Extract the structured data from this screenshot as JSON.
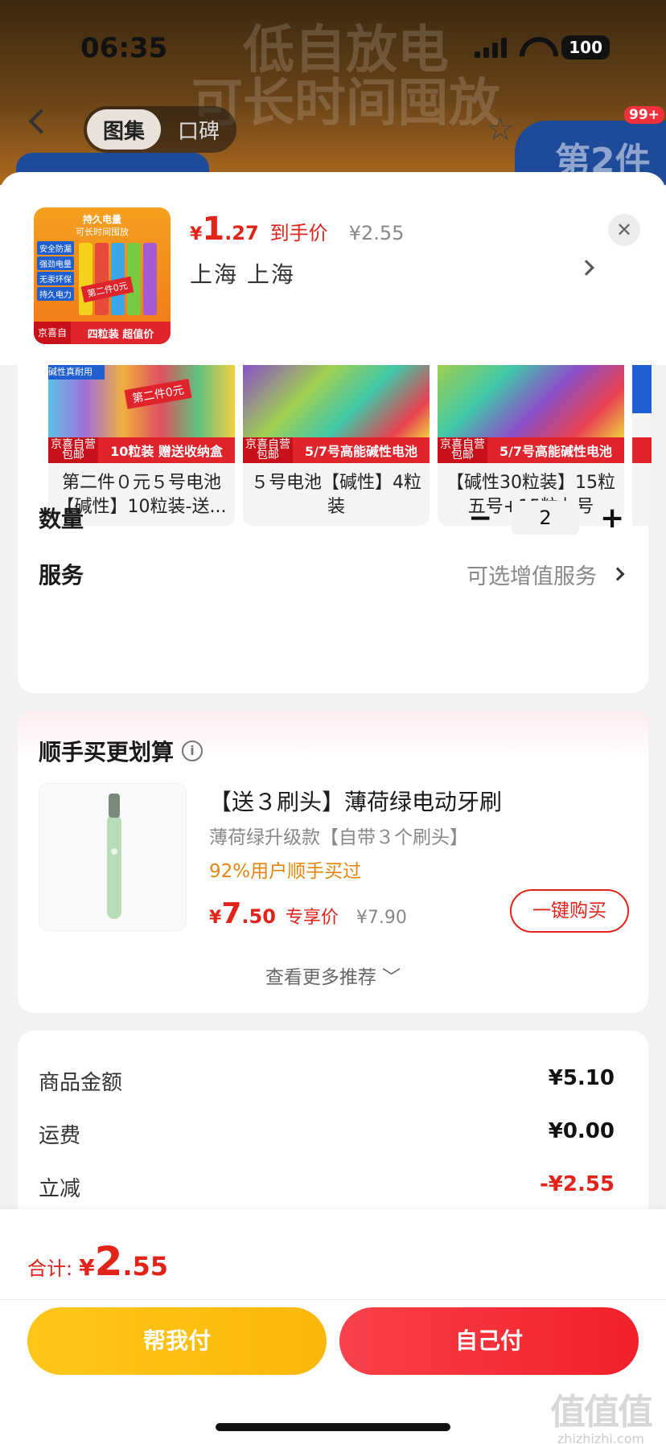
{
  "status": {
    "time": "06:35",
    "battery": "100"
  },
  "background": {
    "ghost_line1": "低自放电",
    "ghost_line2": "可长时间囤放",
    "tab_gallery": "图集",
    "tab_reviews": "口碑",
    "cart_badge": "99+",
    "promo": "第2件"
  },
  "product": {
    "thumb_title": "持久电量",
    "thumb_subtitle": "可长时间囤放",
    "thumb_tags": [
      "安全防漏",
      "强劲电量",
      "无汞环保",
      "持久电力"
    ],
    "thumb_band": "第二件0元",
    "thumb_jd": "京喜自营 包邮",
    "thumb_pack": "四粒装 超值价",
    "price_symbol": "¥",
    "price_int": "1",
    "price_dec": ".27",
    "price_tag": "到手价",
    "price_orig": "¥2.55",
    "address": "上海  上海"
  },
  "variants": [
    {
      "name": "第二件０元５号电池【碱性】10粒装-送...",
      "foot": "10粒装 赠送收纳盒",
      "jd": "京喜自营 包邮",
      "band": "第二件0元"
    },
    {
      "name": "５号电池【碱性】4粒装",
      "foot": "5/7号高能碱性电池",
      "jd": "京喜自营 包邮"
    },
    {
      "name": "【碱性30粒装】15粒五号+15粒七号",
      "foot": "5/7号高能碱性电池",
      "jd": "京喜自营 包邮"
    }
  ],
  "quantity": {
    "label": "数量",
    "minus": "−",
    "value": "2",
    "plus": "+"
  },
  "service": {
    "label": "服务",
    "value": "可选增值服务"
  },
  "recommend": {
    "title": "顺手买更划算",
    "name": "【送３刷头】薄荷绿电动牙刷",
    "sub": "薄荷绿升级款【自带３个刷头】",
    "pct": "92%用户顺手买过",
    "price_symbol": "¥",
    "price_int": "7",
    "price_dec": ".50",
    "price_tag": "专享价",
    "price_orig": "¥7.90",
    "buy": "一键购买",
    "more": "查看更多推荐 ﹀"
  },
  "totals": [
    {
      "label": "商品金额",
      "value": "¥5.10"
    },
    {
      "label": "运费",
      "value": "¥0.00"
    },
    {
      "label": "立减",
      "value": "-¥2.55"
    }
  ],
  "footer": {
    "sum_label": "合计:",
    "sum_symbol": "¥",
    "sum_int": "2",
    "sum_dec": ".55",
    "help_pay": "帮我付",
    "self_pay": "自己付"
  },
  "watermark": {
    "mark": "值值值",
    "text": "zhizhizhi.com"
  },
  "colors": {
    "accent_red": "#e2231a",
    "yellow_button": "#ffc61a",
    "red_button": "#f2202a",
    "orange_text": "#e88410"
  }
}
